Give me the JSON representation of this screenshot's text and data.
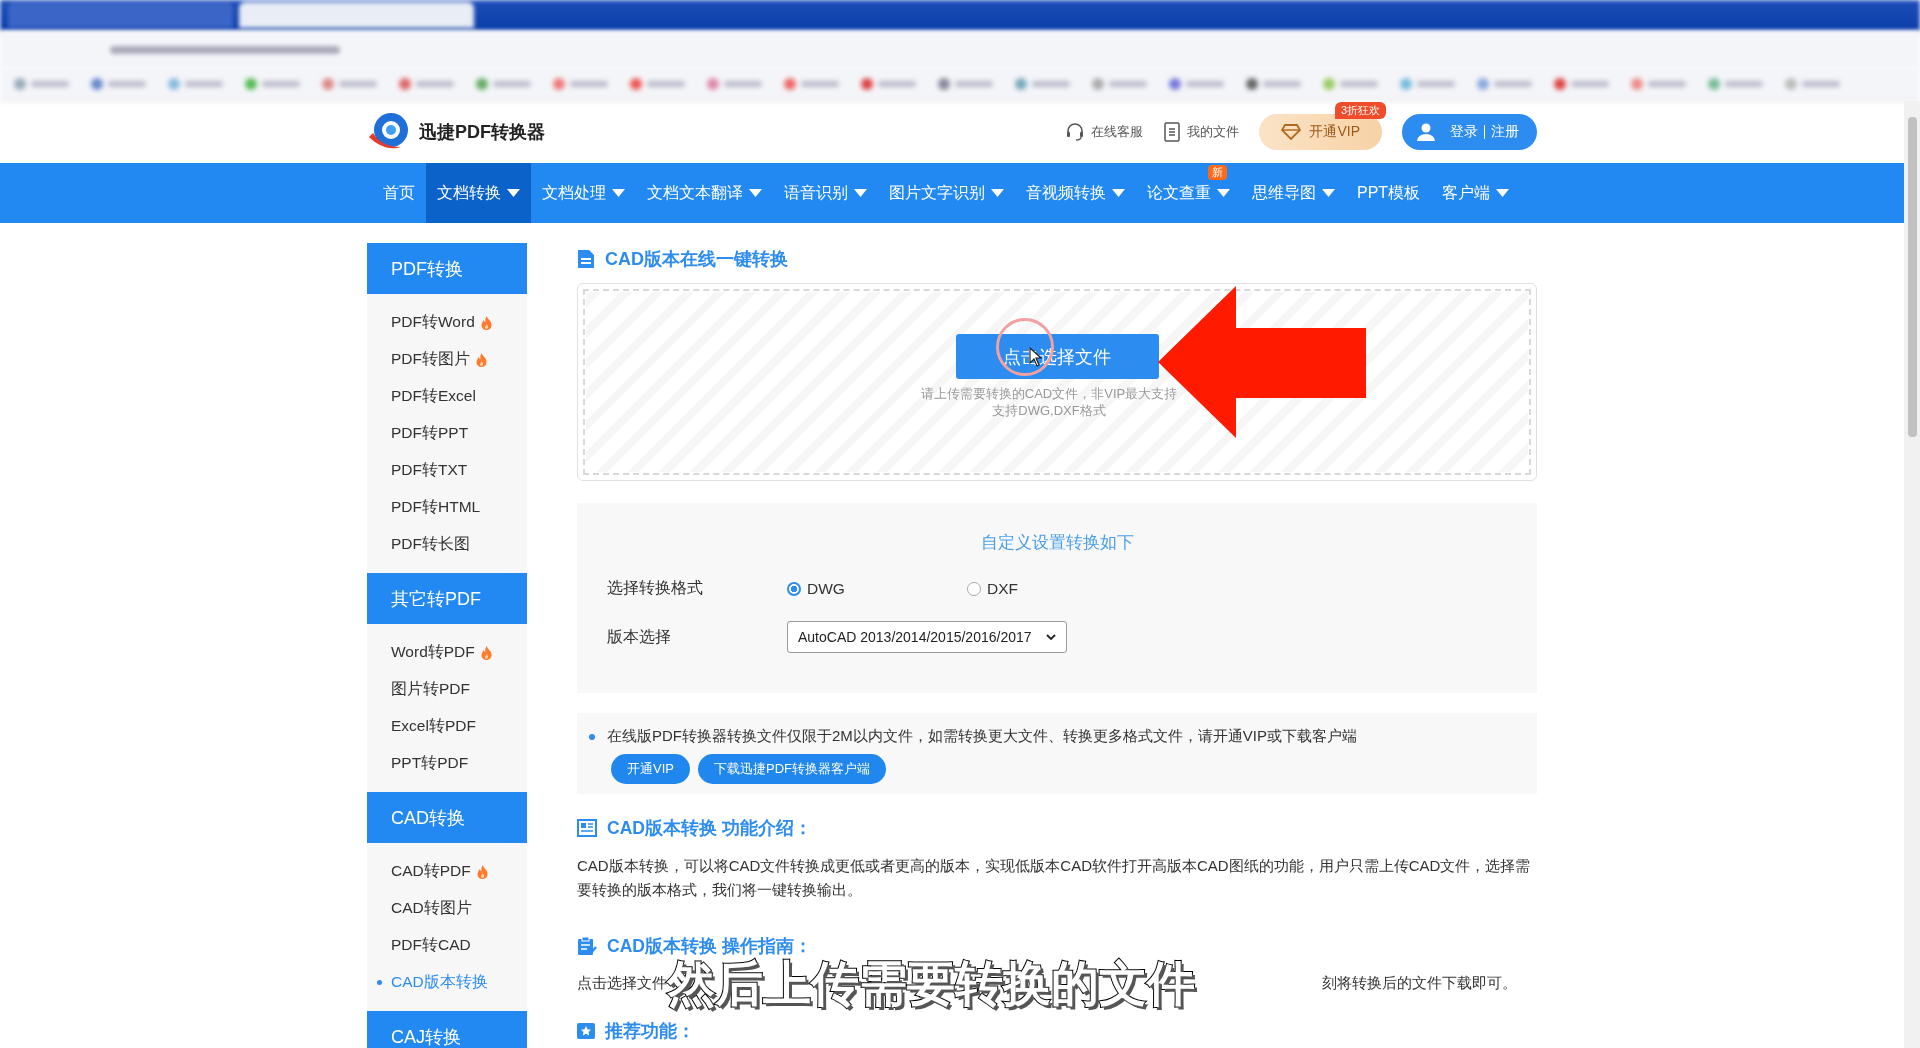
{
  "header": {
    "logo_text": "迅捷PDF转换器",
    "links": [
      {
        "kind": "service",
        "label": "在线客服"
      },
      {
        "kind": "files",
        "label": "我的文件"
      }
    ],
    "vip": {
      "label": "开通VIP",
      "badge": "3折狂欢"
    },
    "login": {
      "label": "登录",
      "register": "注册"
    }
  },
  "nav": [
    {
      "label": "首页",
      "selected": false,
      "dropdown": false
    },
    {
      "label": "文档转换",
      "selected": true,
      "dropdown": true
    },
    {
      "label": "文档处理",
      "selected": false,
      "dropdown": true
    },
    {
      "label": "文档文本翻译",
      "selected": false,
      "dropdown": true
    },
    {
      "label": "语音识别",
      "selected": false,
      "dropdown": true
    },
    {
      "label": "图片文字识别",
      "selected": false,
      "dropdown": true
    },
    {
      "label": "音视频转换",
      "selected": false,
      "dropdown": true
    },
    {
      "label": "论文查重",
      "selected": false,
      "dropdown": true,
      "badge": "新"
    },
    {
      "label": "思维导图",
      "selected": false,
      "dropdown": true
    },
    {
      "label": "PPT模板",
      "selected": false,
      "dropdown": false
    },
    {
      "label": "客户端",
      "selected": false,
      "dropdown": true
    }
  ],
  "sidebar": [
    {
      "title": "PDF转换",
      "items": [
        {
          "label": "PDF转Word",
          "hot": true,
          "selected": false
        },
        {
          "label": "PDF转图片",
          "hot": true,
          "selected": false
        },
        {
          "label": "PDF转Excel",
          "hot": false,
          "selected": false
        },
        {
          "label": "PDF转PPT",
          "hot": false,
          "selected": false
        },
        {
          "label": "PDF转TXT",
          "hot": false,
          "selected": false
        },
        {
          "label": "PDF转HTML",
          "hot": false,
          "selected": false
        },
        {
          "label": "PDF转长图",
          "hot": false,
          "selected": false
        }
      ]
    },
    {
      "title": "其它转PDF",
      "items": [
        {
          "label": "Word转PDF",
          "hot": true,
          "selected": false
        },
        {
          "label": "图片转PDF",
          "hot": false,
          "selected": false
        },
        {
          "label": "Excel转PDF",
          "hot": false,
          "selected": false
        },
        {
          "label": "PPT转PDF",
          "hot": false,
          "selected": false
        }
      ]
    },
    {
      "title": "CAD转换",
      "items": [
        {
          "label": "CAD转PDF",
          "hot": true,
          "selected": false
        },
        {
          "label": "CAD转图片",
          "hot": false,
          "selected": false
        },
        {
          "label": "PDF转CAD",
          "hot": false,
          "selected": false
        },
        {
          "label": "CAD版本转换",
          "hot": false,
          "selected": true
        }
      ]
    },
    {
      "title": "CAJ转换"
    }
  ],
  "upload": {
    "title": "CAD版本在线一键转换",
    "button": "点击选择文件",
    "hints": [
      "请上传需要转换的CAD文件，非VIP最大支持",
      "支持DWG,DXF格式"
    ]
  },
  "settings": {
    "title": "自定义设置转换如下",
    "format_label": "选择转换格式",
    "formats": [
      {
        "label": "DWG",
        "selected": true
      },
      {
        "label": "DXF",
        "selected": false
      }
    ],
    "version_label": "版本选择",
    "version_value": "AutoCAD 2013/2014/2015/2016/2017"
  },
  "notice": {
    "text": "在线版PDF转换器转换文件仅限于2M以内文件，如需转换更大文件、转换更多格式文件，请开通VIP或下载客户端",
    "buttons": [
      "开通VIP",
      "下载迅捷PDF转换器客户端"
    ]
  },
  "intro": {
    "title": "CAD版本转换 功能介绍：",
    "text": "CAD版本转换，可以将CAD文件转换成更低或者更高的版本，实现低版本CAD软件打开高版本CAD图纸的功能，用户只需上传CAD文件，选择需要转换的版本格式，我们将一键转换输出。"
  },
  "guide": {
    "title": "CAD版本转换 操作指南：",
    "text_start": "点击选择文件",
    "text_end": "刻将转换后的文件下载即可。"
  },
  "recommend": {
    "title": "推荐功能："
  },
  "caption": "然后上传需要转换的文件"
}
